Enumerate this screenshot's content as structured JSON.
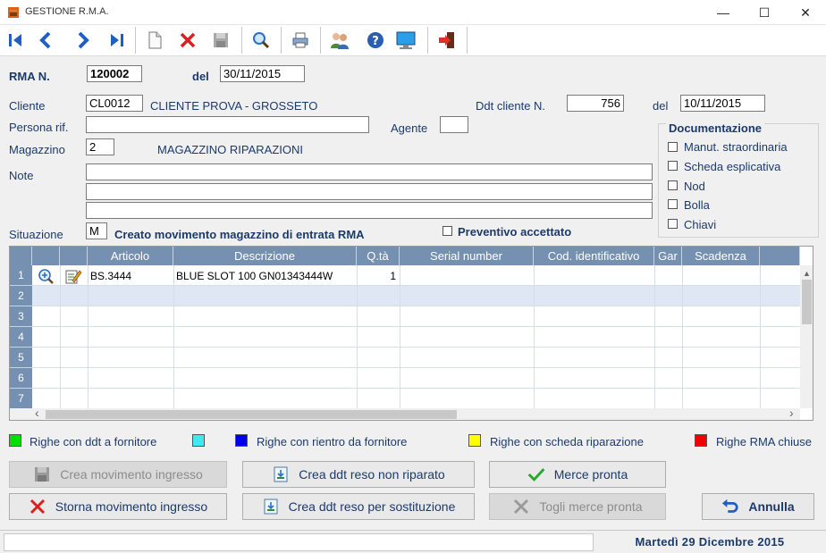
{
  "window": {
    "title": "GESTIONE R.M.A.",
    "controls": {
      "minimize": "—",
      "maximize": "☐",
      "close": "✕"
    }
  },
  "toolbar": {
    "buttons": [
      "first-record-icon",
      "previous-record-icon",
      "next-record-icon",
      "last-record-icon",
      "new-document-icon",
      "delete-icon",
      "save-icon",
      "search-icon",
      "print-icon",
      "users-icon",
      "help-icon",
      "monitor-icon",
      "exit-icon"
    ]
  },
  "header": {
    "rma_label": "RMA  N.",
    "rma_number": "120002",
    "del_label": "del",
    "rma_date": "30/11/2015"
  },
  "form": {
    "cliente_label": "Cliente",
    "cliente_code": "CL0012",
    "cliente_name": "CLIENTE PROVA - GROSSETO",
    "ddt_label": "Ddt cliente N.",
    "ddt_number": "756",
    "ddt_del_label": "del",
    "ddt_date": "10/11/2015",
    "persona_label": "Persona rif.",
    "persona_value": "",
    "agente_label": "Agente",
    "agente_value": "",
    "magazzino_label": "Magazzino",
    "magazzino_code": "2",
    "magazzino_name": "MAGAZZINO RIPARAZIONI",
    "note_label": "Note",
    "note_lines": [
      "",
      "",
      ""
    ],
    "situazione_label": "Situazione",
    "situazione_code": "M",
    "situazione_text": "Creato movimento magazzino di entrata RMA",
    "preventivo_label": "Preventivo accettato"
  },
  "documentazione": {
    "title": "Documentazione",
    "items": [
      "Manut. straordinaria",
      "Scheda esplicativa",
      "Nod",
      "Bolla",
      "Chiavi"
    ]
  },
  "grid": {
    "columns": [
      "Articolo",
      "Descrizione",
      "Q.tà",
      "Serial number",
      "Cod. identificativo",
      "Gar",
      "Scadenza"
    ],
    "row_numbers": [
      "1",
      "2",
      "3",
      "4",
      "5",
      "6",
      "7"
    ],
    "rows": [
      {
        "articolo": "BS.3444",
        "descrizione": "BLUE SLOT 100 GN01343444W",
        "qta": "1",
        "serial": "",
        "cod": "",
        "gar": "",
        "scadenza": ""
      }
    ],
    "scroll_left": "‹",
    "scroll_right": "›"
  },
  "legend": [
    {
      "label": "Righe con ddt a fornitore",
      "color": "#00e000"
    },
    {
      "label": "",
      "color": "#40e8f0"
    },
    {
      "label": "Righe con rientro da fornitore",
      "color": "#0000f0"
    },
    {
      "label": "Righe con scheda riparazione",
      "color": "#ffff00"
    },
    {
      "label": "Righe RMA chiuse",
      "color": "#f00000"
    }
  ],
  "buttons": {
    "crea_movimento": "Crea movimento ingresso",
    "storna_movimento": "Storna movimento ingresso",
    "crea_ddt_non_riparato": "Crea ddt reso non riparato",
    "crea_ddt_sostituzione": "Crea ddt reso per sostituzione",
    "merce_pronta": "Merce pronta",
    "togli_merce_pronta": "Togli merce pronta",
    "annulla": "Annulla"
  },
  "status": {
    "date": "Martedì    29 Dicembre    2015"
  }
}
